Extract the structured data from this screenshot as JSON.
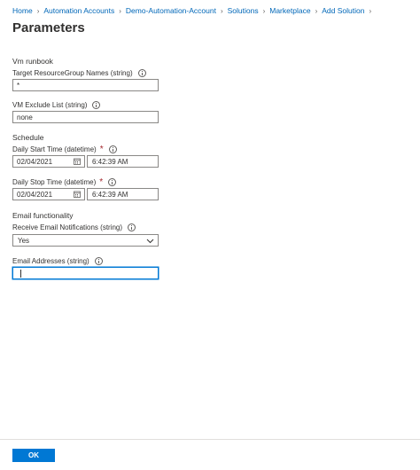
{
  "breadcrumb": [
    {
      "label": "Home"
    },
    {
      "label": "Automation Accounts"
    },
    {
      "label": "Demo-Automation-Account"
    },
    {
      "label": "Solutions"
    },
    {
      "label": "Marketplace"
    },
    {
      "label": "Add Solution"
    }
  ],
  "page_title": "Parameters",
  "vm_runbook": {
    "heading": "Vm runbook",
    "resource_group_label": "Target ResourceGroup Names (string)",
    "resource_group_value": "*",
    "exclude_list_label": "VM Exclude List (string)",
    "exclude_list_value": "none"
  },
  "schedule": {
    "heading": "Schedule",
    "start_label": "Daily Start Time (datetime)",
    "start_date": "02/04/2021",
    "start_time": "6:42:39 AM",
    "stop_label": "Daily Stop Time (datetime)",
    "stop_date": "02/04/2021",
    "stop_time": "6:42:39 AM",
    "required_marker": "*"
  },
  "email": {
    "heading": "Email functionality",
    "notifications_label": "Receive Email Notifications (string)",
    "notifications_value": "Yes",
    "addresses_label": "Email Addresses (string)",
    "addresses_value": ""
  },
  "footer": {
    "ok_label": "OK"
  },
  "colors": {
    "accent": "#0078d4",
    "link": "#0067b8",
    "required": "#a4262c"
  },
  "icons": {
    "info": "info-icon",
    "calendar": "calendar-icon",
    "chevron": "chevron-down-icon",
    "separator": "chevron-right-icon"
  }
}
